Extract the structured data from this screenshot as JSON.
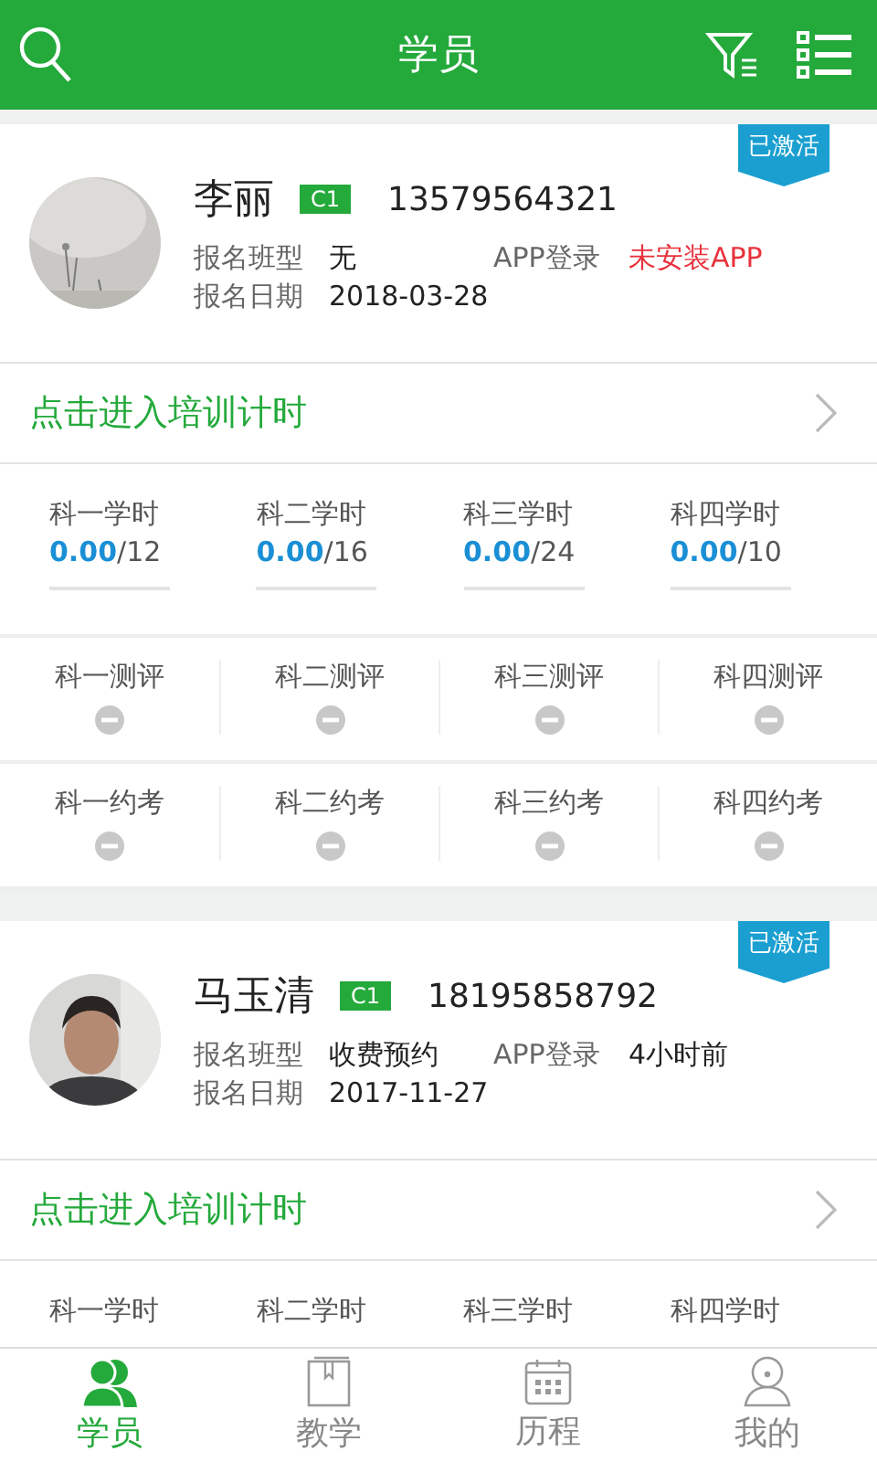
{
  "header": {
    "title": "学员"
  },
  "students": [
    {
      "name": "李丽",
      "license": "C1",
      "phone": "13579564321",
      "badge": "已激活",
      "class_label": "报名班型",
      "class_value": "无",
      "app_label": "APP登录",
      "app_value": "未安装APP",
      "app_installed": false,
      "date_label": "报名日期",
      "date_value": "2018-03-28",
      "training_link": "点击进入培训计时",
      "hours": [
        {
          "label": "科一学时",
          "done": "0.00",
          "total": "/12",
          "level": 0
        },
        {
          "label": "科二学时",
          "done": "0.00",
          "total": "/16",
          "level": 0
        },
        {
          "label": "科三学时",
          "done": "0.00",
          "total": "/24",
          "level": 0
        },
        {
          "label": "科四学时",
          "done": "0.00",
          "total": "/10",
          "level": 0
        }
      ],
      "evaluations": [
        {
          "label": "科一测评",
          "completed": false
        },
        {
          "label": "科二测评",
          "completed": false
        },
        {
          "label": "科三测评",
          "completed": false
        },
        {
          "label": "科四测评",
          "completed": false
        }
      ],
      "exams": [
        {
          "label": "科一约考",
          "completed": false
        },
        {
          "label": "科二约考",
          "completed": false
        },
        {
          "label": "科三约考",
          "completed": false
        },
        {
          "label": "科四约考",
          "completed": false
        }
      ]
    },
    {
      "name": "马玉清",
      "license": "C1",
      "phone": "18195858792",
      "badge": "已激活",
      "class_label": "报名班型",
      "class_value": "收费预约",
      "app_label": "APP登录",
      "app_value": "4小时前",
      "app_installed": true,
      "date_label": "报名日期",
      "date_value": "2017-11-27",
      "training_link": "点击进入培训计时",
      "hours": [
        {
          "label": "科一学时"
        },
        {
          "label": "科二学时"
        },
        {
          "label": "科三学时"
        },
        {
          "label": "科四学时"
        }
      ]
    }
  ],
  "tabs": [
    {
      "label": "学员",
      "selected": true
    },
    {
      "label": "教学",
      "selected": false
    },
    {
      "label": "历程",
      "selected": false
    },
    {
      "label": "我的",
      "selected": false
    }
  ]
}
